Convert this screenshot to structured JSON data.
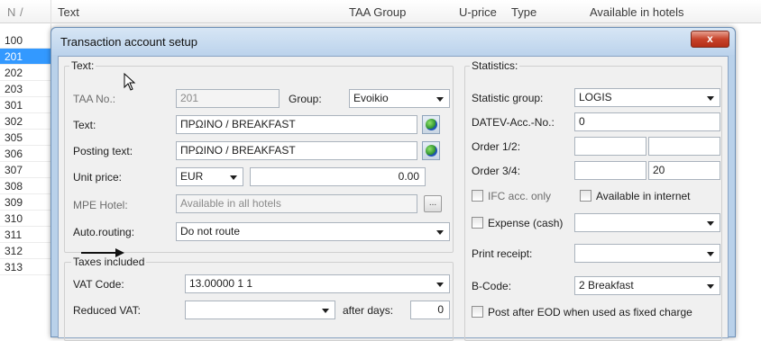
{
  "list": {
    "columns": [
      "N",
      "Text",
      "TAA Group",
      "U-price",
      "Type",
      "Available in hotels"
    ],
    "rows": [
      "100",
      "201",
      "202",
      "203",
      "301",
      "302",
      "305",
      "306",
      "307",
      "308",
      "309",
      "310",
      "311",
      "312",
      "313"
    ],
    "selected_row": "201"
  },
  "dialog": {
    "title": "Transaction account setup",
    "close_label": "x",
    "text_group": {
      "label": "Text:",
      "taa_no_label": "TAA No.:",
      "taa_no_value": "201",
      "group_label": "Group:",
      "group_value": "Evoikio",
      "text_label": "Text:",
      "text_value": "ΠΡΩΙΝΟ / BREAKFAST",
      "posting_text_label": "Posting text:",
      "posting_text_value": "ΠΡΩΙΝΟ / BREAKFAST",
      "unit_price_label": "Unit price:",
      "currency_value": "EUR",
      "unit_price_value": "0.00",
      "mpe_hotel_label": "MPE Hotel:",
      "mpe_hotel_value": "Available in all hotels",
      "browse_label": "...",
      "auto_routing_label": "Auto.routing:",
      "auto_routing_value": "Do not route"
    },
    "taxes_group": {
      "label": "Taxes included",
      "vat_code_label": "VAT Code:",
      "vat_code_value": "13.00000  1 1",
      "reduced_vat_label": "Reduced VAT:",
      "reduced_vat_value": "",
      "after_days_label": "after days:",
      "after_days_value": "0"
    },
    "statistics_group": {
      "label": "Statistics:",
      "statistic_group_label": "Statistic group:",
      "statistic_group_value": "LOGIS",
      "datev_label": "DATEV-Acc.-No.:",
      "datev_value": "0",
      "order12_label": "Order 1/2:",
      "order12_value_a": "",
      "order12_value_b": "",
      "order34_label": "Order 3/4:",
      "order34_value_a": "",
      "order34_value_b": "20",
      "ifc_only_label": "IFC acc. only",
      "internet_label": "Available in internet",
      "expense_label": "Expense (cash)",
      "expense_value": "",
      "print_receipt_label": "Print receipt:",
      "print_receipt_value": "",
      "bcode_label": "B-Code:",
      "bcode_value": "2 Breakfast",
      "post_after_eod_label": "Post after EOD when used as fixed charge"
    }
  },
  "colors": {
    "selection": "#3399ff",
    "dialog_frame": "#b9d1ea",
    "client_bg": "#f0f0f0",
    "close_button": "#c7432b"
  },
  "icons": [
    "globe-icon",
    "globe-icon",
    "close-icon",
    "chevron-down-icon",
    "arrow-right-icon",
    "mouse-cursor-icon"
  ]
}
